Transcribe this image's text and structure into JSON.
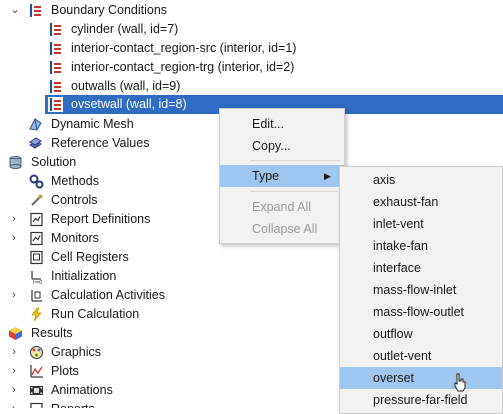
{
  "tree": {
    "boundary_conditions": "Boundary Conditions",
    "bc_items": [
      "cylinder (wall, id=7)",
      "interior-contact_region-src (interior, id=1)",
      "interior-contact_region-trg (interior, id=2)",
      "outwalls (wall, id=9)",
      "ovsetwall (wall, id=8)"
    ],
    "dynamic_mesh": "Dynamic Mesh",
    "reference_values": "Reference Values",
    "solution": "Solution",
    "solution_items": [
      "Methods",
      "Controls",
      "Report Definitions",
      "Monitors",
      "Cell Registers",
      "Initialization",
      "Calculation Activities",
      "Run Calculation"
    ],
    "results": "Results",
    "results_items": [
      "Graphics",
      "Plots",
      "Animations",
      "Reports"
    ]
  },
  "context_menu": {
    "edit": "Edit...",
    "copy": "Copy...",
    "type": "Type",
    "expand_all": "Expand All",
    "collapse_all": "Collapse All"
  },
  "type_submenu": {
    "items": [
      "axis",
      "exhaust-fan",
      "inlet-vent",
      "intake-fan",
      "interface",
      "mass-flow-inlet",
      "mass-flow-outlet",
      "outflow",
      "outlet-vent",
      "overset",
      "pressure-far-field"
    ],
    "selected": "overset"
  },
  "colors": {
    "selection": "#2f6cc2",
    "menu_highlight": "#9fc6ef",
    "bc_icon_red": "#c0392b",
    "bc_icon_blue": "#1f4fa3"
  }
}
